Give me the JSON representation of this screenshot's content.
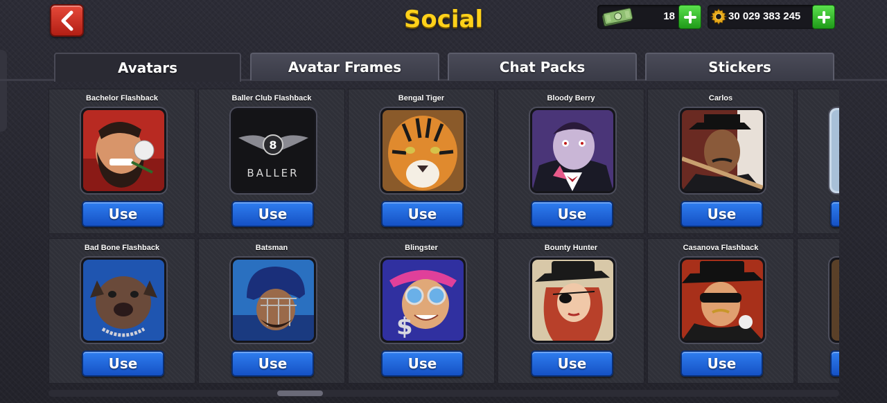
{
  "header": {
    "title": "Social",
    "back_icon": "chevron-left-icon",
    "cash": {
      "icon": "cash-stack-icon",
      "amount": "18"
    },
    "coins": {
      "icon": "gold-gear-coin-icon",
      "amount": "30 029 383 245"
    }
  },
  "tabs": [
    {
      "label": "Avatars",
      "active": true
    },
    {
      "label": "Avatar Frames",
      "active": false
    },
    {
      "label": "Chat Packs",
      "active": false
    },
    {
      "label": "Stickers",
      "active": false
    }
  ],
  "avatars": [
    {
      "name": "Bachelor Flashback",
      "button": "Use",
      "color": "#c8312a"
    },
    {
      "name": "Baller Club Flashback",
      "button": "Use",
      "color": "#1a1a1e"
    },
    {
      "name": "Bengal Tiger",
      "button": "Use",
      "color": "#d9822b"
    },
    {
      "name": "Bloody Berry",
      "button": "Use",
      "color": "#5b3a8a"
    },
    {
      "name": "Carlos",
      "button": "Use",
      "color": "#8a3a2a"
    },
    {
      "name": "Bad Bone Flashback",
      "button": "Use",
      "color": "#2a5fb4"
    },
    {
      "name": "Batsman",
      "button": "Use",
      "color": "#3a8ad0"
    },
    {
      "name": "Blingster",
      "button": "Use",
      "color": "#3a3aa0"
    },
    {
      "name": "Bounty Hunter",
      "button": "Use",
      "color": "#c0a070"
    },
    {
      "name": "Casanova Flashback",
      "button": "Use",
      "color": "#b83a1a"
    }
  ],
  "colors": {
    "title": "#ffd11a",
    "use_button": "#1f66dd",
    "back_button": "#d0372a",
    "plus_button": "#3cc034"
  }
}
